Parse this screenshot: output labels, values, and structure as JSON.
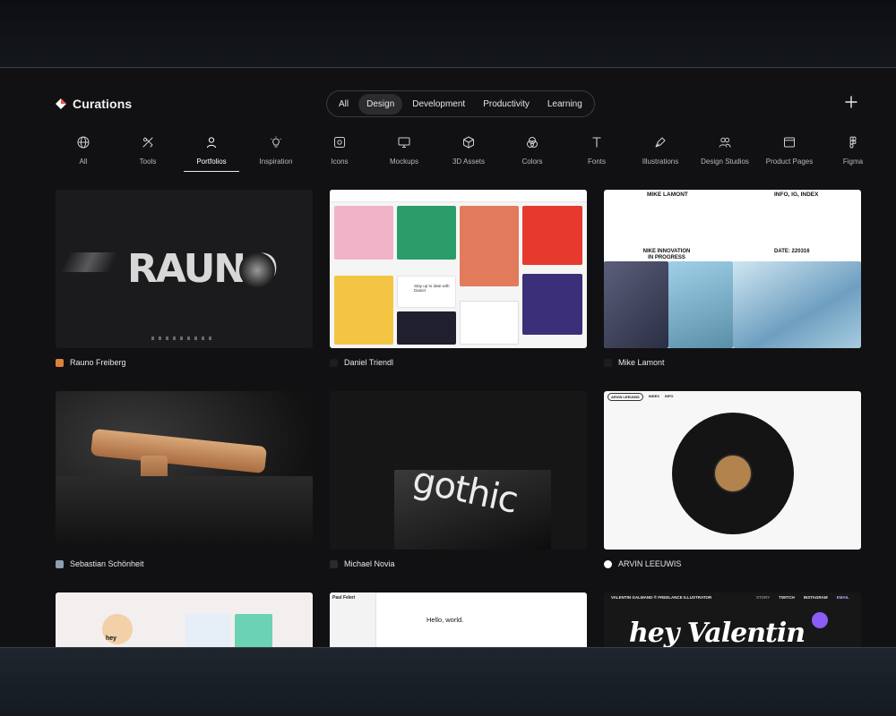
{
  "brand": {
    "name": "Curations",
    "logo_icon": "curations-logo-icon"
  },
  "filters": {
    "items": [
      {
        "label": "All",
        "active": false
      },
      {
        "label": "Design",
        "active": true
      },
      {
        "label": "Development",
        "active": false
      },
      {
        "label": "Productivity",
        "active": false
      },
      {
        "label": "Learning",
        "active": false
      }
    ]
  },
  "add_button_icon": "plus-icon",
  "categories": [
    {
      "label": "All",
      "icon": "globe-icon"
    },
    {
      "label": "Tools",
      "icon": "tools-icon"
    },
    {
      "label": "Portfolios",
      "icon": "person-icon",
      "active": true
    },
    {
      "label": "Inspiration",
      "icon": "lightbulb-icon"
    },
    {
      "label": "Icons",
      "icon": "icon-square-icon"
    },
    {
      "label": "Mockups",
      "icon": "monitor-icon"
    },
    {
      "label": "3D Assets",
      "icon": "cube-icon"
    },
    {
      "label": "Colors",
      "icon": "color-circles-icon"
    },
    {
      "label": "Fonts",
      "icon": "type-icon"
    },
    {
      "label": "Illustrations",
      "icon": "pen-nib-icon"
    },
    {
      "label": "Design Studios",
      "icon": "users-icon"
    },
    {
      "label": "Product Pages",
      "icon": "browser-icon"
    },
    {
      "label": "Figma",
      "icon": "figma-icon"
    }
  ],
  "cards": [
    {
      "name": "Rauno Freiberg",
      "thumb_text": "RAUNO",
      "favicon_color": "#d9823b"
    },
    {
      "name": "Daniel Triendl",
      "thumb_text": "Stay up to date with Daniel",
      "favicon_color": "#1d1d1d"
    },
    {
      "name": "Mike Lamont",
      "thumb_header_left": "MIKE LAMONT",
      "thumb_header_right": "INFO, IG, INDEX",
      "thumb_title": "NIKE INNOVATION IN PROGRESS",
      "thumb_date": "DATE: 220316",
      "favicon_color": "#1d1d1d"
    },
    {
      "name": "Sebastian Schönheit",
      "favicon_color": "#8aa0b0"
    },
    {
      "name": "Michael Novia",
      "thumb_text": "gothic",
      "favicon_color": "#2a2a2a"
    },
    {
      "name": "ARVIN LEEUWIS",
      "thumb_nav": [
        "ARVIN LEEUWIS",
        "INDEX",
        "INFO"
      ],
      "favicon_color": "#ffffff"
    },
    {
      "name": "",
      "thumb_text": "hey",
      "favicon_color": "#f0c9c9"
    },
    {
      "name": "",
      "thumb_text": "Hello, world.",
      "thumb_side_title": "Paul Feleri",
      "favicon_color": "#ffffff"
    },
    {
      "name": "",
      "thumb_header": "VALENTIN GALMAND ® FREELANCE ILLUSTRATOR",
      "thumb_links": [
        "STORY",
        "TWITCH",
        "INSTAGRAM",
        "EMAIL"
      ],
      "thumb_text": "hey Valentin",
      "favicon_color": "#8b5cf6"
    }
  ]
}
